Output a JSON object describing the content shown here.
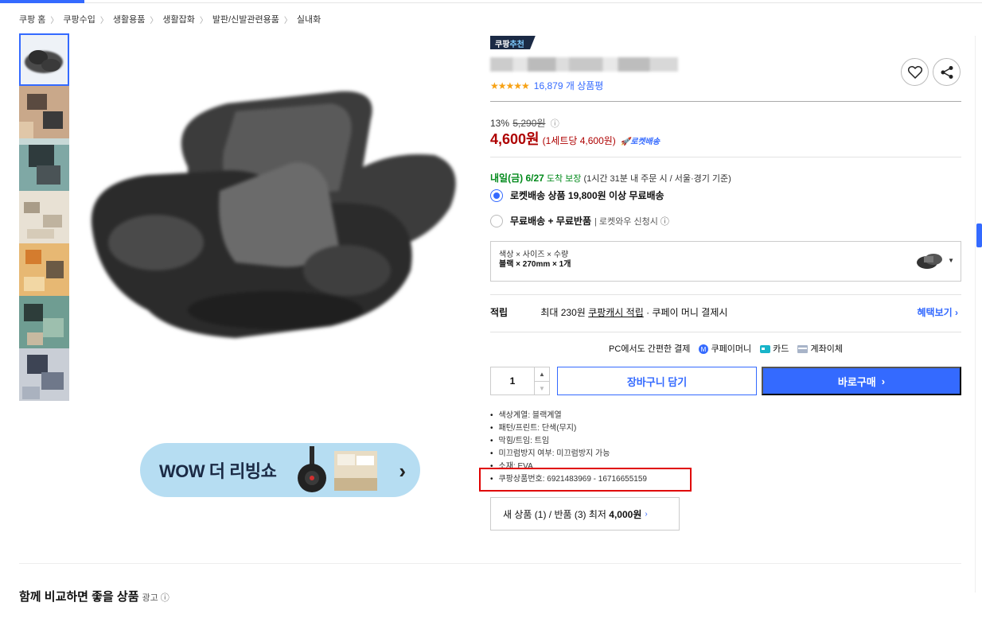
{
  "breadcrumb": [
    "쿠팡 홈",
    "쿠팡수입",
    "생활용품",
    "생활잡화",
    "발판/신발관련용품",
    "실내화"
  ],
  "badge": {
    "prefix": "쿠팡",
    "highlight": "추천"
  },
  "rating": {
    "stars": "★★★★★",
    "review_count": "16,879 개 상품평"
  },
  "price": {
    "discount_rate": "13%",
    "original": "5,290원",
    "final": "4,600원",
    "unit": "(1세트당 4,600원)",
    "rocket_label": "로켓배송"
  },
  "delivery": {
    "date": "내일(금) 6/27",
    "guarantee": "도착 보장",
    "condition": "(1시간 31분 내 주문 시 / 서울·경기 기준)"
  },
  "shipping_options": [
    {
      "label": "로켓배송 상품 19,800원 이상 무료배송",
      "extra": "",
      "selected": true
    },
    {
      "label": "무료배송 + 무료반품",
      "extra": "| 로켓와우 신청시 ⓘ",
      "selected": false
    }
  ],
  "option": {
    "label": "색상 × 사이즈 × 수량",
    "value": "블랙 × 270mm × 1개"
  },
  "benefit": {
    "label": "적립",
    "prefix": "최대 230원",
    "cash": "쿠팡캐시 적립",
    "suffix": "· 쿠페이 머니 결제시",
    "more": "혜택보기 ›"
  },
  "payment": {
    "title": "PC에서도 간편한 결제",
    "methods": [
      "쿠페이머니",
      "카드",
      "계좌이체"
    ]
  },
  "quantity": "1",
  "buttons": {
    "cart": "장바구니 담기",
    "buy": "바로구매"
  },
  "attributes": [
    "색상계열: 블랙계열",
    "패턴/프린트: 단색(무지)",
    "막힘/트임: 트임",
    "미끄럼방지 여부: 미끄럼방지 가능",
    "소재: EVA",
    "쿠팡상품번호: 6921483969 - 16716655159"
  ],
  "sellers": {
    "text": "새 상품 (1) / 반품 (3) 최저",
    "price": "4,000원"
  },
  "promo_banner": {
    "text": "WOW 더 리빙쇼"
  },
  "related": {
    "title": "함께 비교하면 좋을 상품",
    "ad": "광고 ⓘ"
  },
  "colors": {
    "accent": "#346aff",
    "price_red": "#ae0000",
    "delivery_green": "#00891a",
    "highlight_red": "#e00000"
  }
}
